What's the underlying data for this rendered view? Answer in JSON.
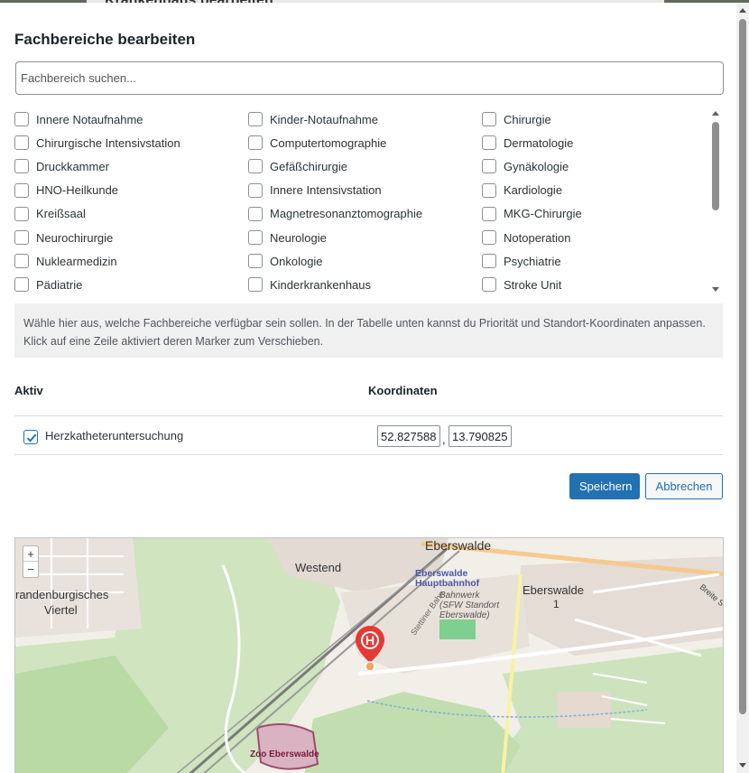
{
  "background": {
    "title": "Krankenhaus bearbeiten"
  },
  "modal": {
    "title": "Fachbereiche bearbeiten",
    "search_placeholder": "Fachbereich suchen...",
    "departments": [
      "Innere Notaufnahme",
      "Kinder-Notaufnahme",
      "Chirurgie",
      "Chirurgische Intensivstation",
      "Computertomographie",
      "Dermatologie",
      "Druckkammer",
      "Gefäßchirurgie",
      "Gynäkologie",
      "HNO-Heilkunde",
      "Innere Intensivstation",
      "Kardiologie",
      "Kreißsaal",
      "Magnetresonanztomographie",
      "MKG-Chirurgie",
      "Neurochirurgie",
      "Neurologie",
      "Notoperation",
      "Nuklearmedizin",
      "Onkologie",
      "Psychiatrie",
      "Pädiatrie",
      "Kinderkrankenhaus",
      "Stroke Unit"
    ],
    "hint": "Wähle hier aus, welche Fachbereiche verfügbar sein sollen. In der Tabelle unten kannst du Priorität und Standort-Koordinaten anpassen. Klick auf eine Zeile aktiviert deren Marker zum Verschieben.",
    "table": {
      "col_active": "Aktiv",
      "col_coords": "Koordinaten",
      "rows": [
        {
          "label": "Herzkatheteruntersuchung",
          "checked": true,
          "lat": "52.827588",
          "lng": "13.790825",
          "separator": ","
        }
      ]
    },
    "buttons": {
      "save": "Speichern",
      "cancel": "Abbrechen"
    },
    "map": {
      "zoom_in": "+",
      "zoom_out": "−",
      "labels": {
        "eberswalde": "Eberswalde",
        "westend": "Westend",
        "brandenburgisches": "randenburgisches",
        "viertel": "Viertel",
        "eberswalde_district": "Eberswalde",
        "district_number": "1",
        "hbf_line1": "Eberswalde",
        "hbf_line2": "Hauptbahnhof",
        "bw_line1": "Bahnwerk",
        "bw_line2": "(SFW Standort",
        "bw_line3": "Eberswalde)",
        "zoo": "Zoo Eberswalde",
        "breite": "Breite S",
        "stettiner": "Stettiner Bahn"
      },
      "marker_letter": "H",
      "marker_color": "#e53935"
    }
  }
}
